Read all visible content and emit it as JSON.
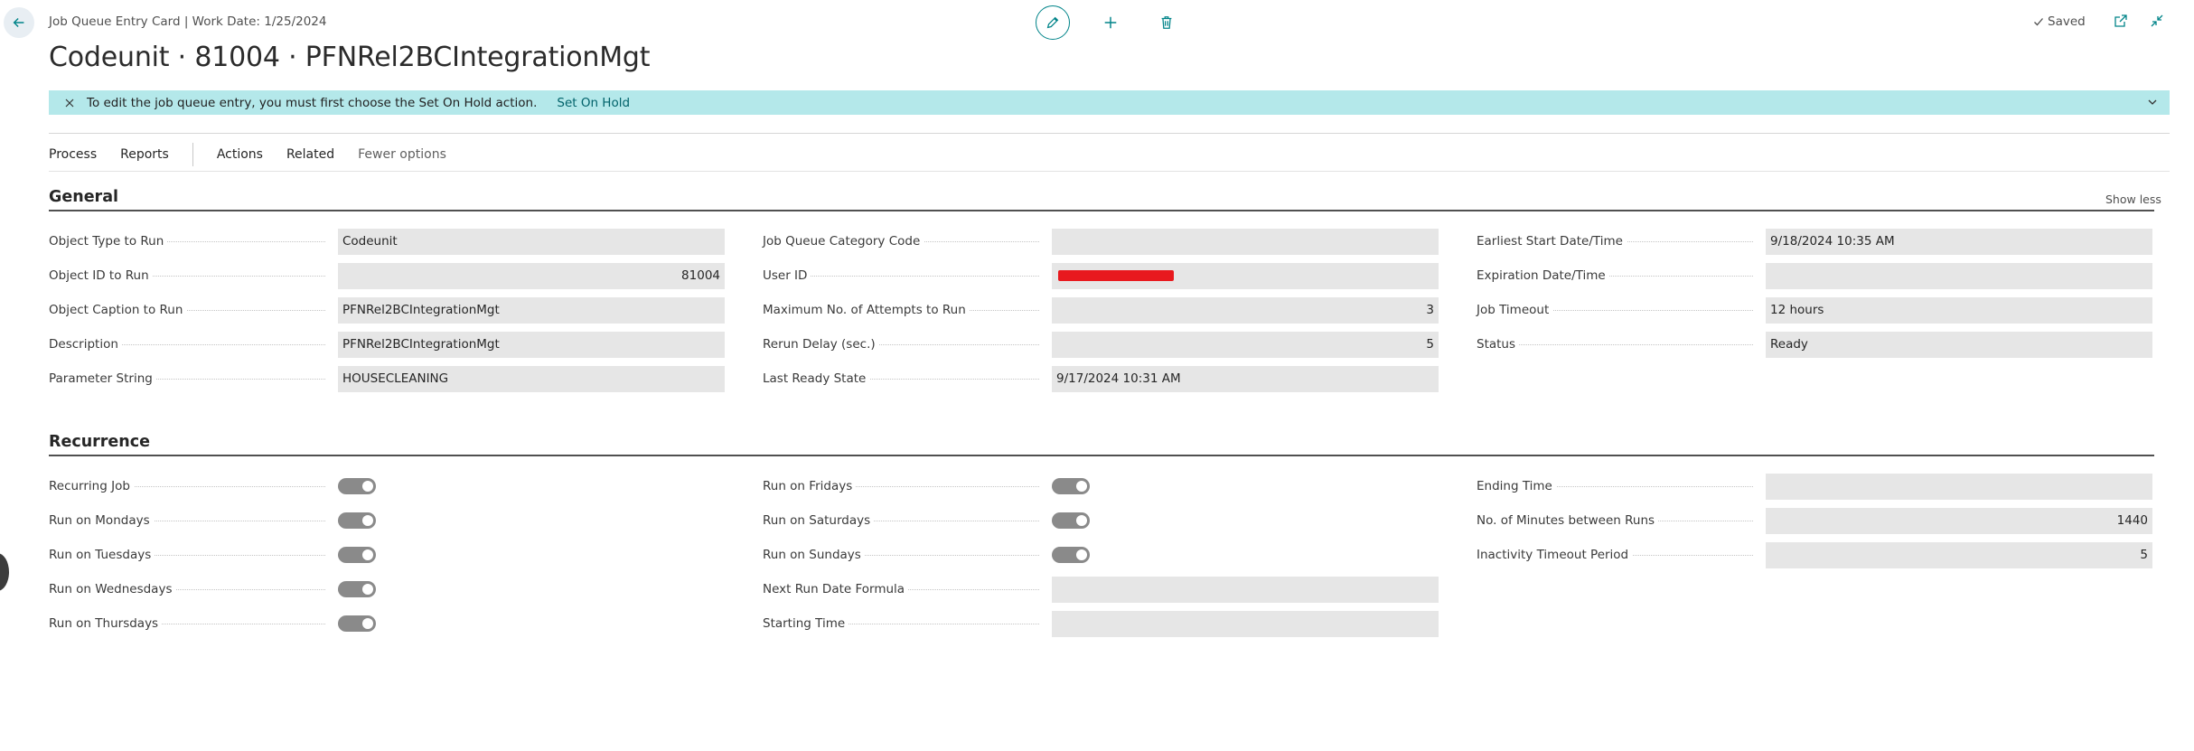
{
  "header": {
    "breadcrumb": "Job Queue Entry Card | Work Date: 1/25/2024",
    "title": "Codeunit · 81004 · PFNRel2BCIntegrationMgt",
    "saved_label": "Saved"
  },
  "notification": {
    "message": "To edit the job queue entry, you must first choose the Set On Hold action.",
    "action_label": "Set On Hold"
  },
  "actionbar": {
    "process": "Process",
    "reports": "Reports",
    "actions": "Actions",
    "related": "Related",
    "fewer": "Fewer options"
  },
  "general": {
    "title": "General",
    "show_less": "Show less",
    "col1": [
      {
        "label": "Object Type to Run",
        "value": "Codeunit"
      },
      {
        "label": "Object ID to Run",
        "value": "81004"
      },
      {
        "label": "Object Caption to Run",
        "value": "PFNRel2BCIntegrationMgt"
      },
      {
        "label": "Description",
        "value": "PFNRel2BCIntegrationMgt"
      },
      {
        "label": "Parameter String",
        "value": "HOUSECLEANING"
      }
    ],
    "col2": [
      {
        "label": "Job Queue Category Code",
        "value": ""
      },
      {
        "label": "User ID",
        "value": ""
      },
      {
        "label": "Maximum No. of Attempts to Run",
        "value": "3"
      },
      {
        "label": "Rerun Delay (sec.)",
        "value": "5"
      },
      {
        "label": "Last Ready State",
        "value": "9/17/2024 10:31 AM"
      }
    ],
    "col3": [
      {
        "label": "Earliest Start Date/Time",
        "value": "9/18/2024 10:35 AM"
      },
      {
        "label": "Expiration Date/Time",
        "value": ""
      },
      {
        "label": "Job Timeout",
        "value": "12 hours"
      },
      {
        "label": "Status",
        "value": "Ready"
      }
    ]
  },
  "recurrence": {
    "title": "Recurrence",
    "col1": [
      {
        "label": "Recurring Job",
        "on": true
      },
      {
        "label": "Run on Mondays",
        "on": true
      },
      {
        "label": "Run on Tuesdays",
        "on": true
      },
      {
        "label": "Run on Wednesdays",
        "on": true
      },
      {
        "label": "Run on Thursdays",
        "on": true
      }
    ],
    "col2": [
      {
        "label": "Run on Fridays",
        "on": true
      },
      {
        "label": "Run on Saturdays",
        "on": true
      },
      {
        "label": "Run on Sundays",
        "on": true
      },
      {
        "label": "Next Run Date Formula",
        "value": ""
      },
      {
        "label": "Starting Time",
        "value": ""
      }
    ],
    "col3": [
      {
        "label": "Ending Time",
        "value": ""
      },
      {
        "label": "No. of Minutes between Runs",
        "value": "1440"
      },
      {
        "label": "Inactivity Timeout Period",
        "value": "5"
      }
    ]
  },
  "colors": {
    "accent": "#008489",
    "notification_bg": "#b4e8ea",
    "field_bg": "#e6e6e6",
    "redaction": "#e8191e"
  }
}
